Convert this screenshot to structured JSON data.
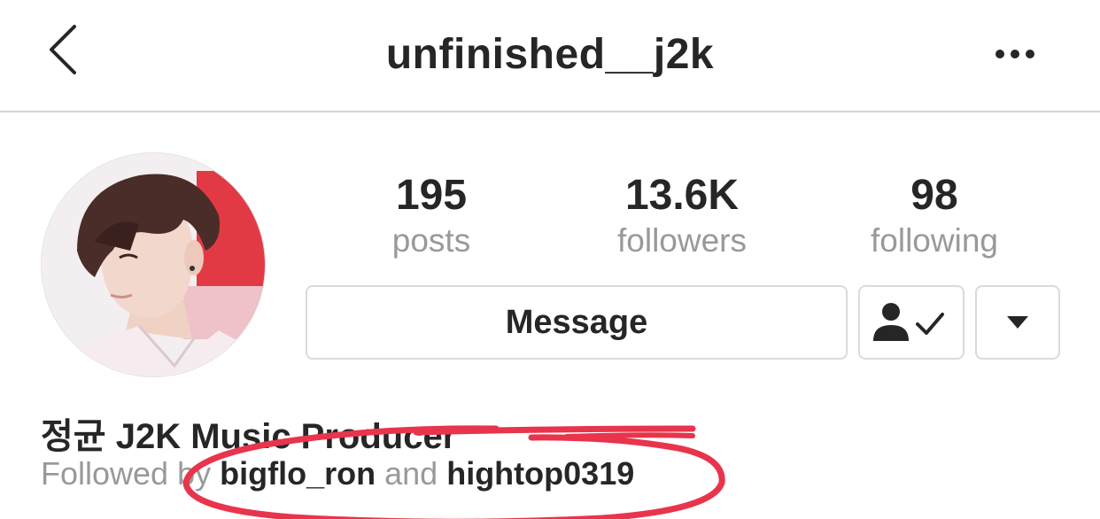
{
  "header": {
    "title": "unfinished__j2k",
    "back_icon": "chevron-left-icon",
    "more_icon": "more-horizontal-icon"
  },
  "stats": {
    "posts": {
      "count": "195",
      "label": "posts"
    },
    "followers": {
      "count": "13.6K",
      "label": "followers"
    },
    "following": {
      "count": "98",
      "label": "following"
    }
  },
  "actions": {
    "message_label": "Message",
    "following_icon": "person-check-icon",
    "dropdown_icon": "triangle-down-icon"
  },
  "bio": {
    "name": "정균 J2K Music Producer",
    "followed_by_prefix": "Followed by",
    "followed_by_user1": "bigflo_ron",
    "followed_by_conj": "and",
    "followed_by_user2": "hightop0319"
  },
  "colors": {
    "text_primary": "#262626",
    "text_secondary": "#999999",
    "border": "#dbdbdb",
    "annotation_red": "#e8344c"
  }
}
